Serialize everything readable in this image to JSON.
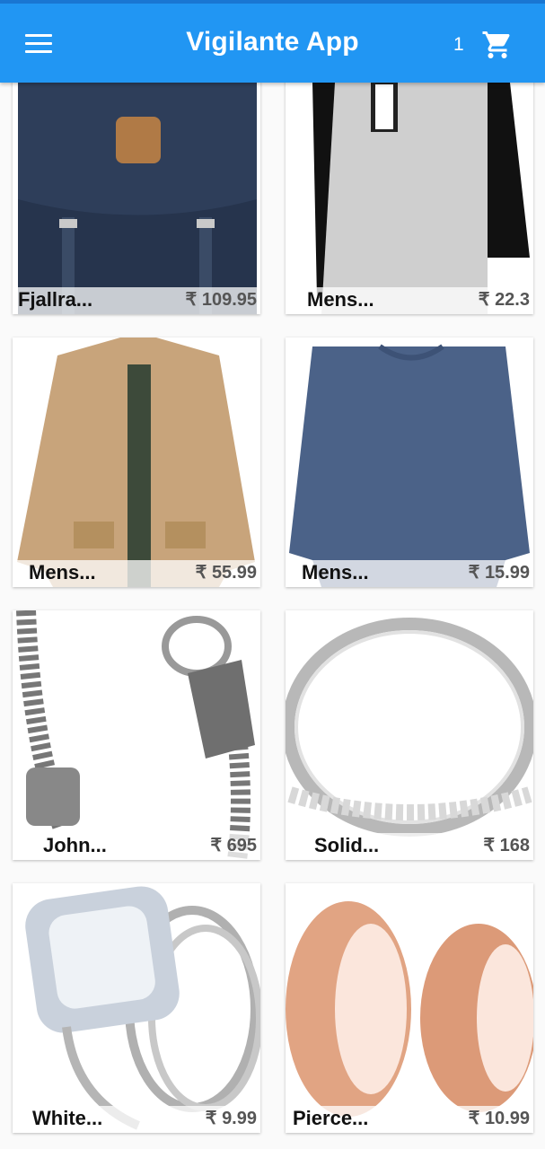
{
  "app": {
    "title": "Vigilante App",
    "cart_count": "1"
  },
  "icons": {
    "menu": "menu-icon",
    "cart": "shopping-cart-icon"
  },
  "colors": {
    "appbar": "#2196f3",
    "appbar_top": "#1976d2"
  },
  "products": [
    {
      "name": "Fjallra...",
      "price": "₹ 109.95",
      "image": "navy-backpack"
    },
    {
      "name": "Mens...",
      "price": "₹ 22.3",
      "image": "raglan-tshirt"
    },
    {
      "name": "Mens...",
      "price": "₹ 55.99",
      "image": "khaki-jacket"
    },
    {
      "name": "Mens...",
      "price": "₹ 15.99",
      "image": "blue-longsleeve-shirt"
    },
    {
      "name": "John...",
      "price": "₹ 695",
      "image": "silver-chain-bracelet"
    },
    {
      "name": "Solid...",
      "price": "₹ 168",
      "image": "silver-ring"
    },
    {
      "name": "White...",
      "price": "₹ 9.99",
      "image": "diamond-ring-set"
    },
    {
      "name": "Pierce...",
      "price": "₹ 10.99",
      "image": "rose-gold-plugs"
    }
  ]
}
